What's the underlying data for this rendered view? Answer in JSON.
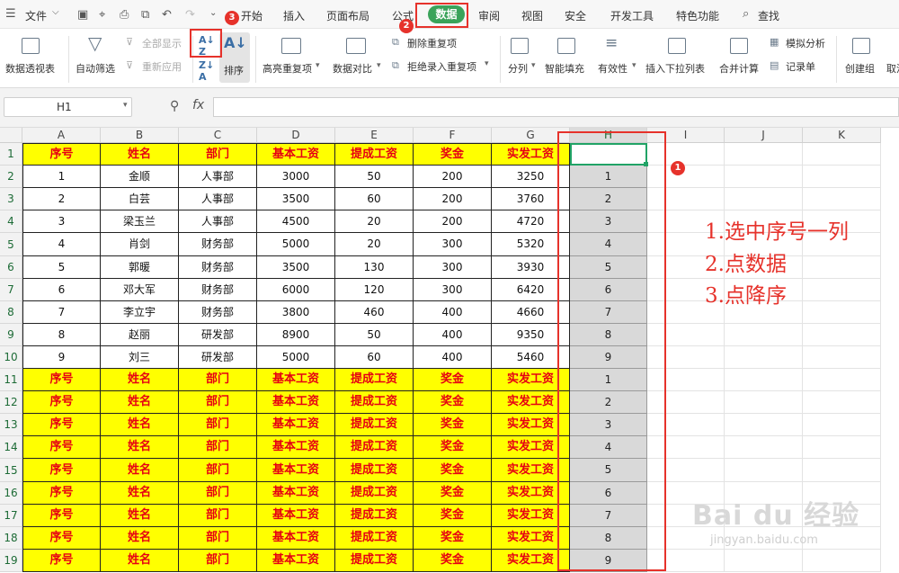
{
  "menu": {
    "file": "文件",
    "tabs": [
      "开始",
      "插入",
      "页面布局",
      "公式",
      "数据",
      "审阅",
      "视图",
      "安全",
      "开发工具",
      "特色功能"
    ],
    "search": "查找"
  },
  "ribbon": {
    "pivot": "数据透视表",
    "auto_filter": "自动筛选",
    "show_all": "全部显示",
    "reapply": "重新应用",
    "sort": "排序",
    "highlight_dup": "高亮重复项",
    "compare": "数据对比",
    "remove_dup": "删除重复项",
    "reject_dup": "拒绝录入重复项",
    "split": "分列",
    "smart_fill": "智能填充",
    "validity": "有效性",
    "insert_dropdown": "插入下拉列表",
    "consolidate": "合并计算",
    "simulate": "模拟分析",
    "record": "记录单",
    "create_group": "创建组",
    "cancel_short": "取消"
  },
  "formula_bar": {
    "name_box": "H1",
    "fx": "fx",
    "formula": ""
  },
  "columns": [
    "A",
    "B",
    "C",
    "D",
    "E",
    "F",
    "G",
    "H",
    "I",
    "J",
    "K"
  ],
  "header_row": [
    "序号",
    "姓名",
    "部门",
    "基本工资",
    "提成工资",
    "奖金",
    "实发工资"
  ],
  "data_rows": [
    [
      "1",
      "金顺",
      "人事部",
      "3000",
      "50",
      "200",
      "3250"
    ],
    [
      "2",
      "白芸",
      "人事部",
      "3500",
      "60",
      "200",
      "3760"
    ],
    [
      "3",
      "梁玉兰",
      "人事部",
      "4500",
      "20",
      "200",
      "4720"
    ],
    [
      "4",
      "肖剑",
      "财务部",
      "5000",
      "20",
      "300",
      "5320"
    ],
    [
      "5",
      "郭暖",
      "财务部",
      "3500",
      "130",
      "300",
      "3930"
    ],
    [
      "6",
      "邓大军",
      "财务部",
      "6000",
      "120",
      "300",
      "6420"
    ],
    [
      "7",
      "李立宇",
      "财务部",
      "3800",
      "460",
      "400",
      "4660"
    ],
    [
      "8",
      "赵丽",
      "研发部",
      "8900",
      "50",
      "400",
      "9350"
    ],
    [
      "9",
      "刘三",
      "研发部",
      "5000",
      "60",
      "400",
      "5460"
    ]
  ],
  "h_values": [
    "",
    "1",
    "2",
    "3",
    "4",
    "5",
    "6",
    "7",
    "8",
    "9",
    "1",
    "2",
    "3",
    "4",
    "5",
    "6",
    "7",
    "8",
    "9"
  ],
  "row_numbers": [
    "1",
    "2",
    "3",
    "4",
    "5",
    "6",
    "7",
    "8",
    "9",
    "10",
    "11",
    "12",
    "13",
    "14",
    "15",
    "16",
    "17",
    "18",
    "19"
  ],
  "badges": [
    "1",
    "2",
    "3"
  ],
  "notes": [
    "1.选中序号一列",
    "2.点数据",
    "3.点降序"
  ],
  "watermark": {
    "logo": "Bai du 经验",
    "url": "jingyan.baidu.com"
  },
  "colors": {
    "accent": "#3aa35a",
    "header_fill": "#ffff00",
    "header_text": "#e60012",
    "annotation": "#e6322b",
    "selection": "#21a366"
  }
}
